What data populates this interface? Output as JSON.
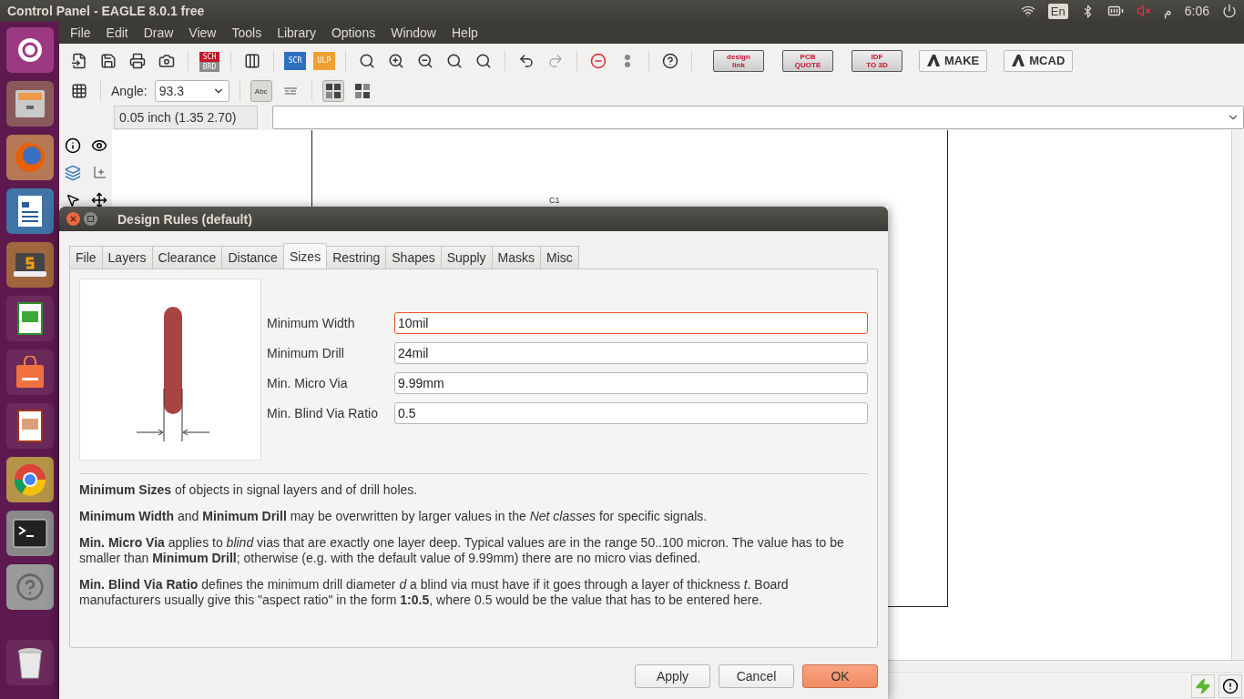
{
  "top_bar": {
    "title": "Control Panel - EAGLE 8.0.1 free",
    "keyboard": "En",
    "period": "م",
    "clock": "6:06"
  },
  "menu": [
    "File",
    "Edit",
    "Draw",
    "View",
    "Tools",
    "Library",
    "Options",
    "Window",
    "Help"
  ],
  "toolbar": {
    "sch_brd": {
      "lines": [
        "SCH",
        "BRD"
      ],
      "pressed": false
    },
    "scr": "SCR",
    "ulp": "ULP",
    "badges": [
      {
        "lines": [
          "design",
          "link"
        ]
      },
      {
        "lines": [
          "PCB",
          "QUOTE"
        ]
      },
      {
        "lines": [
          "IDF",
          "TO 3D"
        ]
      }
    ],
    "actions": [
      {
        "label": "MAKE"
      },
      {
        "label": "MCAD"
      }
    ]
  },
  "options_bar": {
    "angle_label": "Angle:",
    "angle": "93.3",
    "text_modes": [
      {
        "label": "Abc",
        "selected": true
      },
      {
        "selected": false
      }
    ],
    "layouts": [
      {
        "selected": true
      },
      {
        "selected": false
      }
    ]
  },
  "command_bar": {
    "grid": "0.05 inch (1.35 2.70)"
  },
  "canvas": {
    "part_label": "C1"
  },
  "dialog": {
    "title": "Design Rules (default)",
    "tabs": [
      {
        "label": "File",
        "selected": false
      },
      {
        "label": "Layers",
        "selected": false
      },
      {
        "label": "Clearance",
        "selected": false
      },
      {
        "label": "Distance",
        "selected": false
      },
      {
        "label": "Sizes",
        "selected": true
      },
      {
        "label": "Restring",
        "selected": false
      },
      {
        "label": "Shapes",
        "selected": false
      },
      {
        "label": "Supply",
        "selected": false
      },
      {
        "label": "Masks",
        "selected": false
      },
      {
        "label": "Misc",
        "selected": false
      }
    ],
    "fields": [
      {
        "label": "Minimum Width",
        "value": "10mil",
        "focused": true
      },
      {
        "label": "Minimum Drill",
        "value": "24mil",
        "focused": false
      },
      {
        "label": "Min. Micro Via",
        "value": "9.99mm",
        "focused": false
      },
      {
        "label": "Min. Blind Via Ratio",
        "value": "0.5",
        "focused": false
      }
    ],
    "notes": [
      "**Minimum Sizes** of objects in signal layers and of drill holes.",
      "**Minimum Width** and **Minimum Drill** may be overwritten by larger values in the *Net classes* for specific signals.",
      "**Min. Micro Via** applies to *blind* vias that are exactly one layer deep. Typical values are in the range 50..100 micron. The value has to be smaller than **Minimum Drill**; otherwise (e.g. with the default value of 9.99mm) there are no micro vias defined.",
      "**Min. Blind Via Ratio** defines the minimum drill diameter *d* a blind via must have if it goes through a layer of thickness *t*. Board manufacturers usually give this \"aspect ratio\" in the form **1:0.5**, where 0.5 would be the value that has to be entered here."
    ],
    "buttons": [
      {
        "label": "Apply",
        "kind": "normal"
      },
      {
        "label": "Cancel",
        "kind": "normal"
      },
      {
        "label": "OK",
        "kind": "default"
      }
    ]
  }
}
